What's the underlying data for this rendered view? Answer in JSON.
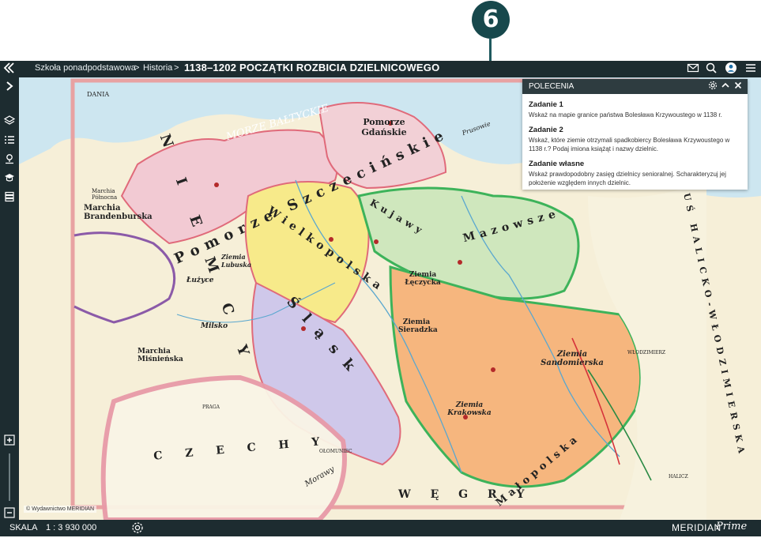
{
  "callout": {
    "number": "6"
  },
  "topbar": {
    "breadcrumb": [
      "Szkoła ponadpodstawowa",
      "Historia"
    ],
    "separator": ">",
    "title": "1138–1202 POCZĄTKI ROZBICIA DZIELNICOWEGO",
    "icons": [
      "mail-icon",
      "search-icon",
      "user-icon",
      "menu-icon"
    ]
  },
  "sidebar": {
    "icons": [
      "collapse-icon",
      "expand-icon",
      "layers-icon",
      "list-icon",
      "map-pin-icon",
      "school-icon",
      "stack-icon",
      "zoom-in-icon",
      "zoom-out-icon"
    ]
  },
  "panel": {
    "title": "POLECENIA",
    "tasks": [
      {
        "title": "Zadanie 1",
        "text": "Wskaż na mapie granice państwa Bolesława Krzywoustego w 1138 r."
      },
      {
        "title": "Zadanie 2",
        "text": "Wskaż, które ziemie otrzymali spadkobiercy Bolesława Krzywoustego w 1138 r.? Podaj imiona książąt i nazwy dzielnic."
      },
      {
        "title": "Zadanie własne",
        "text": "Wskaż prawdopodobny zasięg dzielnicy senioralnej. Scharakteryzuj jej położenie względem innych dzielnic."
      }
    ]
  },
  "map": {
    "copyright": "© Wydawnictwo MERIDIAN",
    "labels": {
      "dania": "DANIA",
      "morze": "MORZE BAŁTYCKIE",
      "pomorze_gdanskie": "Pomorze Gdańskie",
      "pomorze_szczecinskie": "Pomorze Szczecińskie",
      "wielkopolska": "Wielkopolska",
      "mazowsze": "Mazowsze",
      "kujawy": "Kujawy",
      "slask": "Śląsk",
      "malopolska": "Małopolska",
      "ziemia_leczycka": "Ziemia Łęczycka",
      "ziemia_sieradzka": "Ziemia Sieradzka",
      "ziemia_sandomierska": "Ziemia Sandomierska",
      "ziemia_krakowska": "Ziemia Krakowska",
      "ziemia_lubuska": "Ziemia Lubuska",
      "czechy": "C Z E C H Y",
      "wegry": "W Ę G R Y",
      "marchia_brandenburska": "Marchia Brandenburska",
      "marchia_polnocna": "Marchia Północna",
      "marchia_misnienska": "Marchia Miśnieńska",
      "niemcy": "N I E M C Y",
      "rus": "RUŚ HALICKO-WŁODZIMIERSKA",
      "milsko": "Milsko",
      "luzyce": "Łużyce",
      "morawy": "Morawy",
      "prusowie": "Prusowie",
      "wloclawek": "WŁODZIMIERZ",
      "praga": "PRAGA",
      "halicz": "HALICZ",
      "olomuniec": "OŁOMUNIEC"
    }
  },
  "bottombar": {
    "scale_label": "SKALA",
    "scale_value": "1 : 3 930 000",
    "brand": "MERIDIAN",
    "brand_sub": "Prime"
  }
}
